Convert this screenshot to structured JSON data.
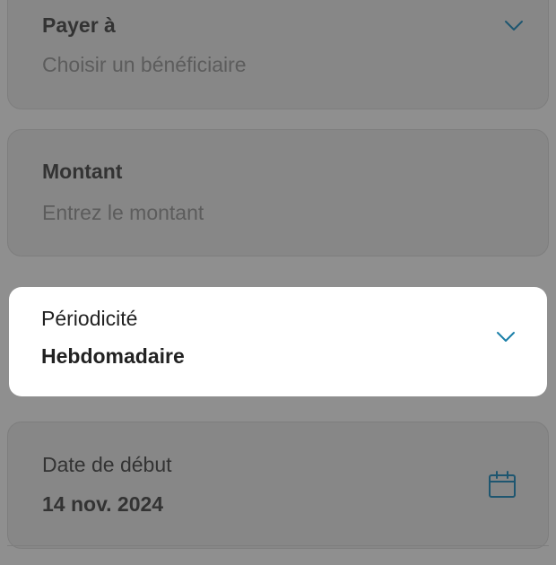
{
  "payee": {
    "label": "Payer à",
    "placeholder": "Choisir un bénéficiaire"
  },
  "amount": {
    "label": "Montant",
    "placeholder": "Entrez le montant"
  },
  "periodicity": {
    "label": "Périodicité",
    "value": "Hebdomadaire"
  },
  "start_date": {
    "label": "Date de début",
    "value": "14 nov. 2024"
  },
  "icons": {
    "payee": "chevron-down-icon",
    "periodicity": "chevron-down-icon",
    "start_date": "calendar-icon"
  },
  "colors": {
    "accent": "#1a7fa8",
    "overlay": "#8f8f8f",
    "card_active": "#ffffff"
  }
}
